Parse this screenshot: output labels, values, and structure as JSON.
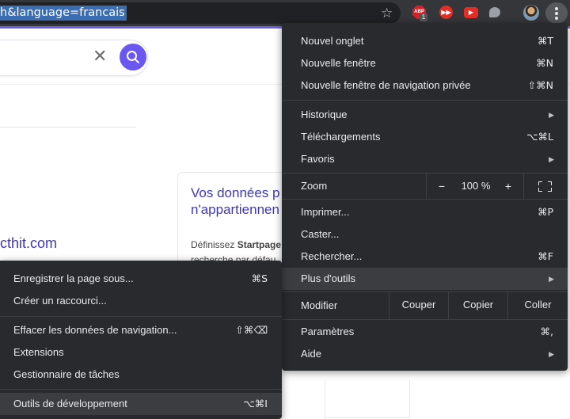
{
  "toolbar": {
    "url_text": "h&language=francais",
    "extensions": {
      "adblock_label": "ABP",
      "adblock_badge": "1"
    }
  },
  "page": {
    "result_link": "cthit.com",
    "card_title": "Vos données p n'appartiennen",
    "card_text_bold": "Startpage",
    "card_text_prefix": "Définissez ",
    "card_text_line2": "recherche par défau"
  },
  "main_menu": {
    "new_tab": {
      "label": "Nouvel onglet",
      "shortcut": "⌘T"
    },
    "new_window": {
      "label": "Nouvelle fenêtre",
      "shortcut": "⌘N"
    },
    "incognito": {
      "label": "Nouvelle fenêtre de navigation privée",
      "shortcut": "⇧⌘N"
    },
    "history": {
      "label": "Historique"
    },
    "downloads": {
      "label": "Téléchargements",
      "shortcut": "⌥⌘L"
    },
    "bookmarks": {
      "label": "Favoris"
    },
    "zoom": {
      "label": "Zoom",
      "minus": "−",
      "value": "100 %",
      "plus": "+"
    },
    "print": {
      "label": "Imprimer...",
      "shortcut": "⌘P"
    },
    "cast": {
      "label": "Caster..."
    },
    "find": {
      "label": "Rechercher...",
      "shortcut": "⌘F"
    },
    "more_tools": {
      "label": "Plus d'outils"
    },
    "edit": {
      "label": "Modifier",
      "cut": "Couper",
      "copy": "Copier",
      "paste": "Coller"
    },
    "settings": {
      "label": "Paramètres",
      "shortcut": "⌘,"
    },
    "help": {
      "label": "Aide"
    }
  },
  "sub_menu": {
    "save_page": {
      "label": "Enregistrer la page sous...",
      "shortcut": "⌘S"
    },
    "create_shortcut": {
      "label": "Créer un raccourci..."
    },
    "clear_data": {
      "label": "Effacer les données de navigation...",
      "shortcut": "⇧⌘⌫"
    },
    "extensions": {
      "label": "Extensions"
    },
    "task_manager": {
      "label": "Gestionnaire de tâches"
    },
    "dev_tools": {
      "label": "Outils de développement",
      "shortcut": "⌥⌘I"
    }
  },
  "colors": {
    "accent": "#6a56f0",
    "menu_bg": "#292a2d",
    "menu_highlight": "#3c3d40",
    "link": "#3d35c5"
  }
}
